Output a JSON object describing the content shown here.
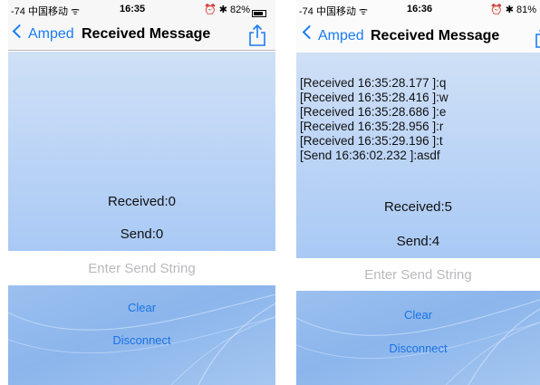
{
  "left": {
    "status": {
      "carrier": "-74 中国移动 ᯤ",
      "time": "16:35",
      "right": "⏰ ✱ 82%",
      "battery_level": 0.82
    },
    "nav": {
      "back_label": "Amped",
      "title": "Received Message"
    },
    "log": "",
    "received_label": "Received:0",
    "send_label": "Send:0",
    "input_placeholder": "Enter Send String",
    "clear_label": "Clear",
    "disconnect_label": "Disconnect"
  },
  "right": {
    "status": {
      "carrier": "-74 中国移动 ᯤ",
      "time": "16:36",
      "right": "⏰ ✱ 81%"
    },
    "nav": {
      "back_label": "Amped",
      "title": "Received Message"
    },
    "log": "[Received 16:35:28.177 ]:q\n[Received 16:35:28.416 ]:w\n[Received 16:35:28.686 ]:e\n[Received 16:35:28.956 ]:r\n[Received 16:35:29.196 ]:t\n[Send 16:36:02.232 ]:asdf",
    "received_label": "Received:5",
    "send_label": "Send:4",
    "input_placeholder": "Enter Send String",
    "clear_label": "Clear",
    "disconnect_label": "Disconnect"
  },
  "colors": {
    "accent": "#1a7cf5",
    "button_text": "#1b73e3"
  }
}
